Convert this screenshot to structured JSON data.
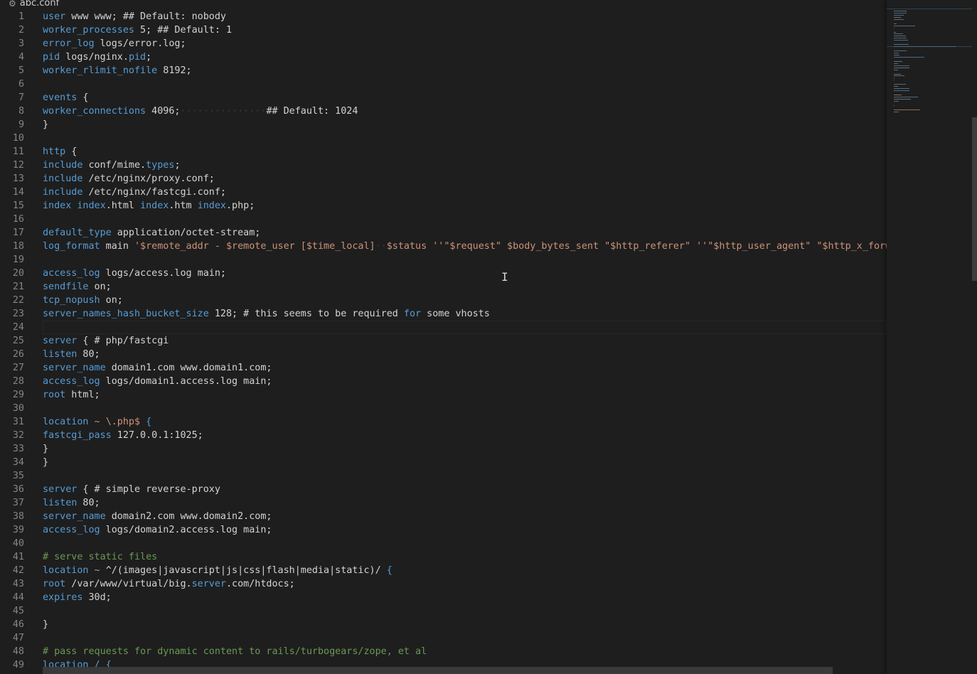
{
  "tab": {
    "filename": "abc.conf",
    "icon": "gear-icon"
  },
  "lines": [
    {
      "n": "1",
      "segs": [
        {
          "t": "user",
          "c": "k"
        },
        {
          "t": " www www; ## Default: nobody"
        }
      ]
    },
    {
      "n": "2",
      "segs": [
        {
          "t": "worker_processes",
          "c": "k"
        },
        {
          "t": " 5; ## Default: 1"
        }
      ]
    },
    {
      "n": "3",
      "segs": [
        {
          "t": "error_log",
          "c": "k"
        },
        {
          "t": " logs/error.log;"
        }
      ]
    },
    {
      "n": "4",
      "segs": [
        {
          "t": "pid",
          "c": "k"
        },
        {
          "t": " logs/nginx."
        },
        {
          "t": "pid",
          "c": "k"
        },
        {
          "t": ";"
        }
      ]
    },
    {
      "n": "5",
      "segs": [
        {
          "t": "worker_rlimit_nofile",
          "c": "k"
        },
        {
          "t": " 8192;"
        }
      ]
    },
    {
      "n": "6",
      "segs": []
    },
    {
      "n": "7",
      "segs": [
        {
          "t": "events",
          "c": "k"
        },
        {
          "t": " {"
        }
      ]
    },
    {
      "n": "8",
      "segs": [
        {
          "t": "worker_connections",
          "c": "k"
        },
        {
          "t": " 4096;"
        },
        {
          "t": "···············",
          "c": "ws"
        },
        {
          "t": "## Default: 1024"
        }
      ]
    },
    {
      "n": "9",
      "segs": [
        {
          "t": "}"
        }
      ]
    },
    {
      "n": "10",
      "segs": []
    },
    {
      "n": "11",
      "segs": [
        {
          "t": "http",
          "c": "k"
        },
        {
          "t": " {"
        }
      ]
    },
    {
      "n": "12",
      "segs": [
        {
          "t": "include",
          "c": "k"
        },
        {
          "t": " conf/mime."
        },
        {
          "t": "types",
          "c": "k"
        },
        {
          "t": ";"
        }
      ]
    },
    {
      "n": "13",
      "segs": [
        {
          "t": "include",
          "c": "k"
        },
        {
          "t": " /etc/nginx/proxy.conf;"
        }
      ]
    },
    {
      "n": "14",
      "segs": [
        {
          "t": "include",
          "c": "k"
        },
        {
          "t": " /etc/nginx/fastcgi.conf;"
        }
      ]
    },
    {
      "n": "15",
      "segs": [
        {
          "t": "index",
          "c": "k"
        },
        {
          "t": " "
        },
        {
          "t": "index",
          "c": "k"
        },
        {
          "t": ".html "
        },
        {
          "t": "index",
          "c": "k"
        },
        {
          "t": ".htm "
        },
        {
          "t": "index",
          "c": "k"
        },
        {
          "t": ".php;"
        }
      ]
    },
    {
      "n": "16",
      "segs": []
    },
    {
      "n": "17",
      "segs": [
        {
          "t": "default_type",
          "c": "k"
        },
        {
          "t": " application/octet-stream;"
        }
      ]
    },
    {
      "n": "18",
      "segs": [
        {
          "t": "log_format",
          "c": "k"
        },
        {
          "t": " main "
        },
        {
          "t": "'$remote_addr - $remote_user [$time_local]",
          "c": "s"
        },
        {
          "t": "··",
          "c": "ws"
        },
        {
          "t": "$status ''\"$request\" $body_bytes_sent \"$http_referer\" ''\"$http_user_agent\" \"$http_x_forwarded_for\"';",
          "c": "s"
        }
      ]
    },
    {
      "n": "19",
      "segs": []
    },
    {
      "n": "20",
      "segs": [
        {
          "t": "access_log",
          "c": "k"
        },
        {
          "t": " logs/access.log main;"
        }
      ]
    },
    {
      "n": "21",
      "segs": [
        {
          "t": "sendfile",
          "c": "k"
        },
        {
          "t": " on;"
        }
      ]
    },
    {
      "n": "22",
      "segs": [
        {
          "t": "tcp_nopush",
          "c": "k"
        },
        {
          "t": " on;"
        }
      ]
    },
    {
      "n": "23",
      "segs": [
        {
          "t": "server_names_hash_bucket_size",
          "c": "k"
        },
        {
          "t": " 128; # this seems to be required "
        },
        {
          "t": "for",
          "c": "k"
        },
        {
          "t": " some vhosts"
        }
      ]
    },
    {
      "n": "24",
      "segs": [],
      "current": true
    },
    {
      "n": "25",
      "segs": [
        {
          "t": "server",
          "c": "k"
        },
        {
          "t": " { # php/fastcgi"
        }
      ]
    },
    {
      "n": "26",
      "segs": [
        {
          "t": "listen",
          "c": "k"
        },
        {
          "t": " 80;"
        }
      ]
    },
    {
      "n": "27",
      "segs": [
        {
          "t": "server_name",
          "c": "k"
        },
        {
          "t": " domain1.com www.domain1.com;"
        }
      ]
    },
    {
      "n": "28",
      "segs": [
        {
          "t": "access_log",
          "c": "k"
        },
        {
          "t": " logs/domain1.access.log main;"
        }
      ]
    },
    {
      "n": "29",
      "segs": [
        {
          "t": "root",
          "c": "k"
        },
        {
          "t": " html;"
        }
      ]
    },
    {
      "n": "30",
      "segs": []
    },
    {
      "n": "31",
      "segs": [
        {
          "t": "location",
          "c": "k"
        },
        {
          "t": " ~ ",
          "c": "s"
        },
        {
          "t": "\\.php$",
          "c": "s"
        },
        {
          "t": " {",
          "c": "k"
        }
      ]
    },
    {
      "n": "32",
      "segs": [
        {
          "t": "fastcgi_pass",
          "c": "k"
        },
        {
          "t": " 127.0.0.1:1025;"
        }
      ]
    },
    {
      "n": "33",
      "segs": [
        {
          "t": "}"
        }
      ]
    },
    {
      "n": "34",
      "segs": [
        {
          "t": "}"
        }
      ]
    },
    {
      "n": "35",
      "segs": []
    },
    {
      "n": "36",
      "segs": [
        {
          "t": "server",
          "c": "k"
        },
        {
          "t": " { # simple reverse-proxy"
        }
      ]
    },
    {
      "n": "37",
      "segs": [
        {
          "t": "listen",
          "c": "k"
        },
        {
          "t": " 80;"
        }
      ]
    },
    {
      "n": "38",
      "segs": [
        {
          "t": "server_name",
          "c": "k"
        },
        {
          "t": " domain2.com www.domain2.com;"
        }
      ]
    },
    {
      "n": "39",
      "segs": [
        {
          "t": "access_log",
          "c": "k"
        },
        {
          "t": " logs/domain2.access.log main;"
        }
      ]
    },
    {
      "n": "40",
      "segs": []
    },
    {
      "n": "41",
      "segs": [
        {
          "t": "# serve static files",
          "c": "c"
        }
      ]
    },
    {
      "n": "42",
      "segs": [
        {
          "t": "location",
          "c": "k"
        },
        {
          "t": " ~ ",
          "c": "s"
        },
        {
          "t": "^/(images|javascript|js|css|flash|media|static)/"
        },
        {
          "t": " {",
          "c": "k"
        }
      ]
    },
    {
      "n": "43",
      "segs": [
        {
          "t": "root",
          "c": "k"
        },
        {
          "t": " /var/www/virtual/big."
        },
        {
          "t": "server",
          "c": "k"
        },
        {
          "t": ".com/htdocs;"
        }
      ]
    },
    {
      "n": "44",
      "segs": [
        {
          "t": "expires",
          "c": "k"
        },
        {
          "t": " 30d;"
        }
      ]
    },
    {
      "n": "45",
      "segs": []
    },
    {
      "n": "46",
      "segs": [
        {
          "t": "}"
        }
      ]
    },
    {
      "n": "47",
      "segs": []
    },
    {
      "n": "48",
      "segs": [
        {
          "t": "# pass requests for dynamic content to rails/turbogears/zope, et al",
          "c": "c"
        }
      ]
    },
    {
      "n": "49",
      "segs": [
        {
          "t": "location",
          "c": "k"
        },
        {
          "t": " / {",
          "c": "k"
        }
      ]
    }
  ],
  "colors": {
    "keyword": "#569cd6",
    "string": "#ce9178",
    "comment": "#6a9955",
    "text": "#d4d4d4",
    "background": "#1e1e1e"
  }
}
